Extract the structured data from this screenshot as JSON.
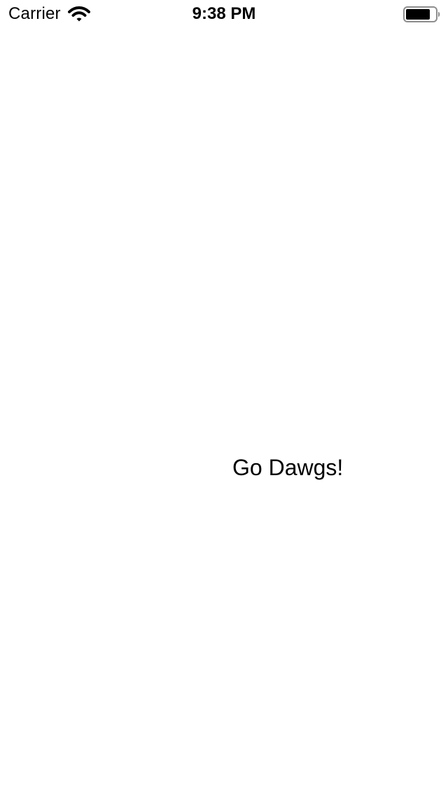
{
  "status_bar": {
    "carrier": "Carrier",
    "time": "9:38 PM",
    "signal_icon": "wifi-icon",
    "battery_icon": "battery-icon"
  },
  "main": {
    "message": "Go Dawgs!"
  },
  "colors": {
    "background": "#ffffff",
    "text": "#000000"
  }
}
